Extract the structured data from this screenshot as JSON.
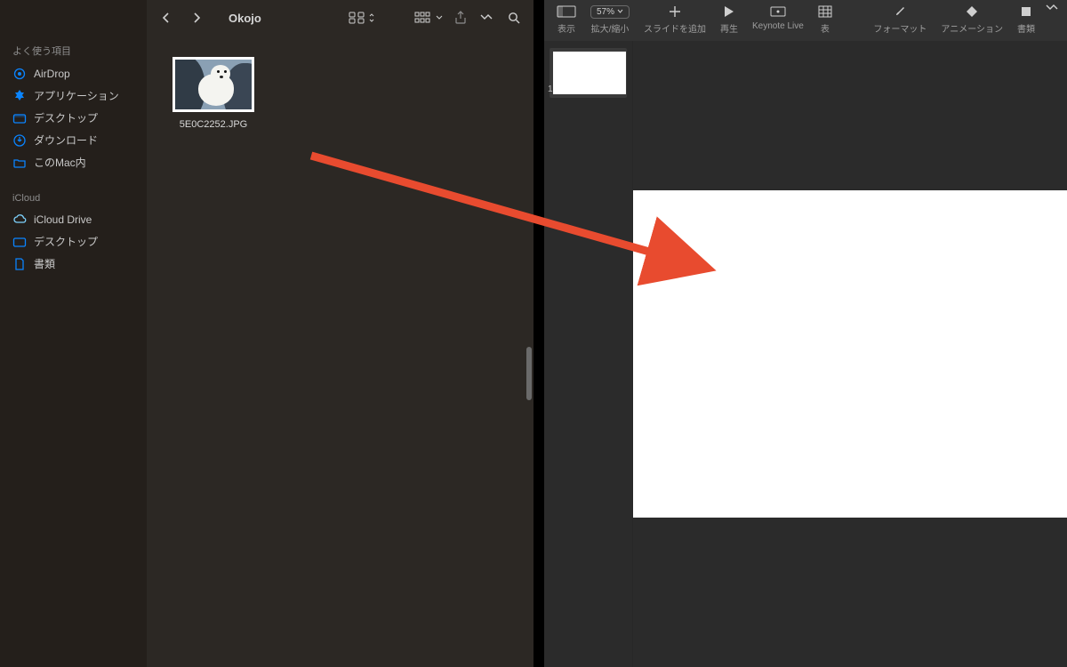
{
  "finder": {
    "title": "Okojo",
    "sidebar": {
      "favorites_header": "よく使う項目",
      "favorites": [
        {
          "id": "airdrop",
          "label": "AirDrop",
          "color": "#0a84ff",
          "icon": "airdrop"
        },
        {
          "id": "applications",
          "label": "アプリケーション",
          "color": "#0a84ff",
          "icon": "apps"
        },
        {
          "id": "desktop",
          "label": "デスクトップ",
          "color": "#0a84ff",
          "icon": "folder"
        },
        {
          "id": "downloads",
          "label": "ダウンロード",
          "color": "#0a84ff",
          "icon": "download"
        },
        {
          "id": "thismac",
          "label": "このMac内",
          "color": "#0a84ff",
          "icon": "folder"
        }
      ],
      "icloud_header": "iCloud",
      "icloud": [
        {
          "id": "iclouddrive",
          "label": "iCloud Drive",
          "color": "#5ac8fa",
          "icon": "cloud"
        },
        {
          "id": "desktop2",
          "label": "デスクトップ",
          "color": "#0a84ff",
          "icon": "folder"
        },
        {
          "id": "documents",
          "label": "書類",
          "color": "#0a84ff",
          "icon": "doc"
        }
      ]
    },
    "file": {
      "name": "5E0C2252.JPG"
    }
  },
  "keynote": {
    "zoom": "57%",
    "toolbar": {
      "view": "表示",
      "zoom": "拡大/縮小",
      "addslide": "スライドを追加",
      "play": "再生",
      "live": "Keynote Live",
      "table": "表",
      "format": "フォーマット",
      "animate": "アニメーション",
      "document": "書類"
    },
    "slide_number": "1"
  }
}
